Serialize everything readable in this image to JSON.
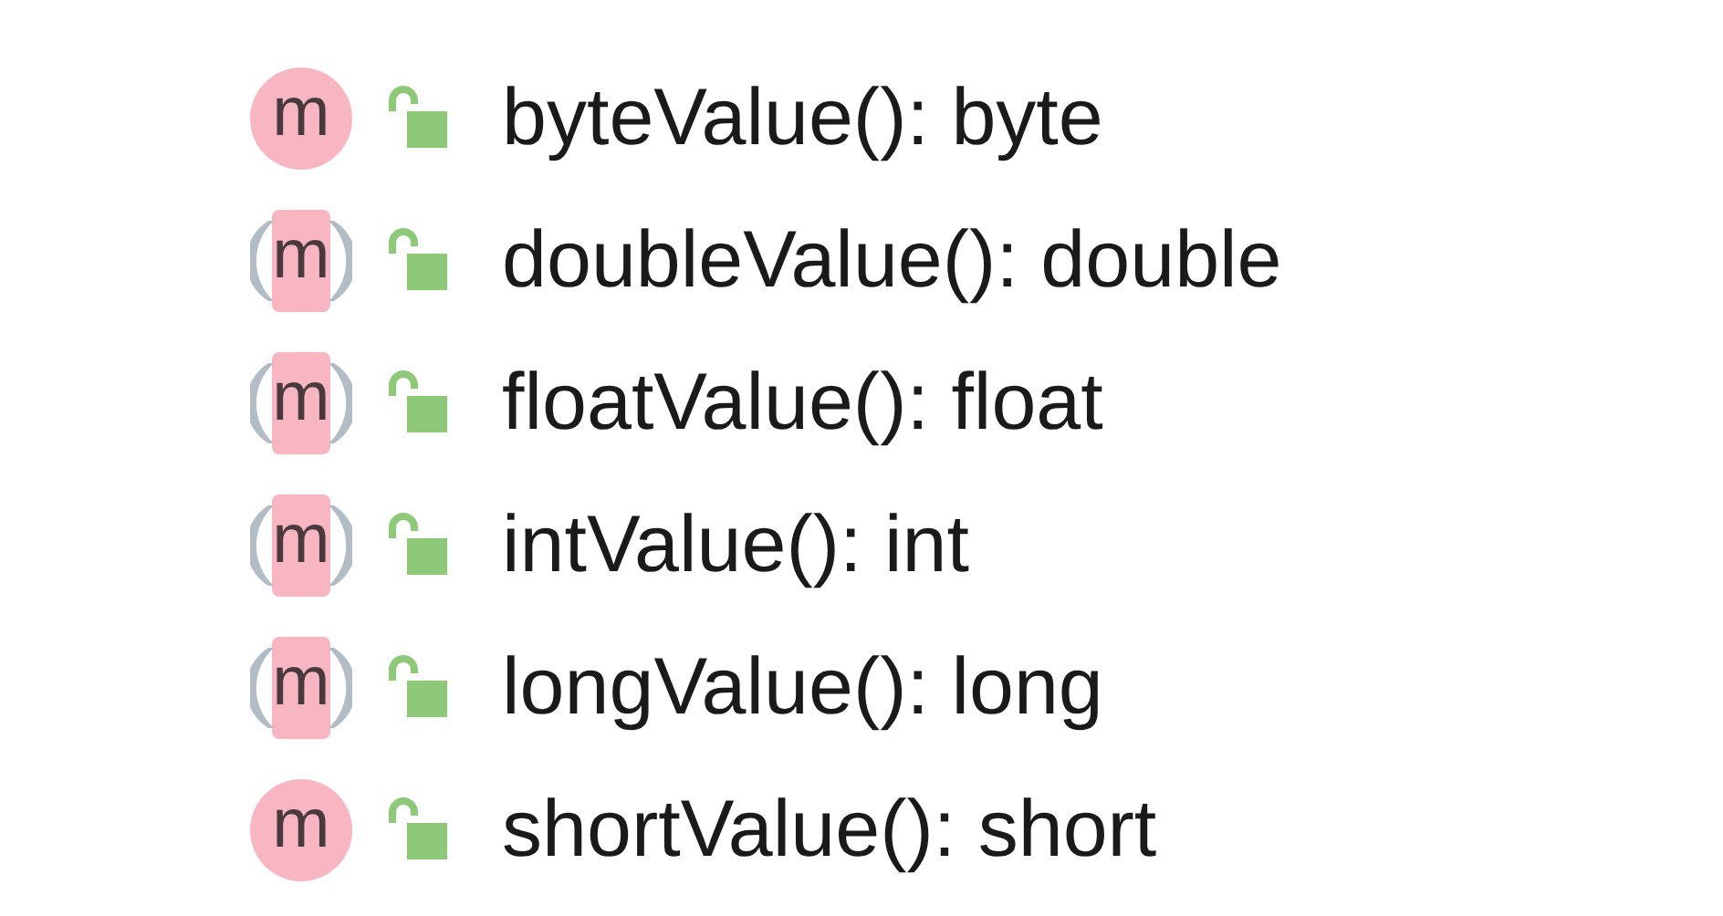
{
  "methods": [
    {
      "kind": "concrete",
      "icon_letter": "m",
      "label": "byteValue(): byte"
    },
    {
      "kind": "abstract",
      "icon_letter": "m",
      "label": "doubleValue(): double"
    },
    {
      "kind": "abstract",
      "icon_letter": "m",
      "label": "floatValue(): float"
    },
    {
      "kind": "abstract",
      "icon_letter": "m",
      "label": "intValue(): int"
    },
    {
      "kind": "abstract",
      "icon_letter": "m",
      "label": "longValue(): long"
    },
    {
      "kind": "concrete",
      "icon_letter": "m",
      "label": "shortValue(): short"
    }
  ]
}
